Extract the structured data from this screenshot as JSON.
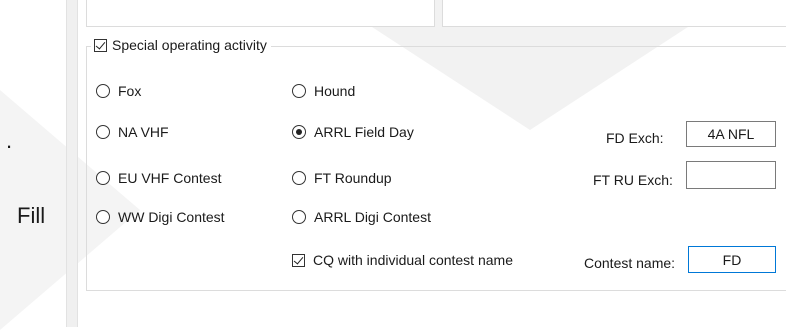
{
  "background": {
    "left_dot": ".",
    "left_text": "Fill"
  },
  "group": {
    "checkbox_label": "Special operating activity",
    "checked": true
  },
  "radios": {
    "fox": {
      "label": "Fox",
      "selected": false
    },
    "hound": {
      "label": "Hound",
      "selected": false
    },
    "na_vhf": {
      "label": "NA VHF",
      "selected": false
    },
    "arrl_field_day": {
      "label": "ARRL Field Day",
      "selected": true
    },
    "eu_vhf": {
      "label": "EU VHF Contest",
      "selected": false
    },
    "ft_roundup": {
      "label": "FT Roundup",
      "selected": false
    },
    "ww_digi": {
      "label": "WW Digi Contest",
      "selected": false
    },
    "arrl_digi": {
      "label": "ARRL Digi Contest",
      "selected": false
    }
  },
  "cq_checkbox": {
    "label": "CQ with individual contest name",
    "checked": true
  },
  "fields": {
    "fd_exch": {
      "label": "FD Exch:",
      "value": "4A NFL"
    },
    "ft_ru_exch": {
      "label": "FT RU Exch:",
      "value": ""
    },
    "contest_name": {
      "label": "Contest name:",
      "value": "FD"
    }
  },
  "colors": {
    "focus_border": "#0078d7"
  }
}
